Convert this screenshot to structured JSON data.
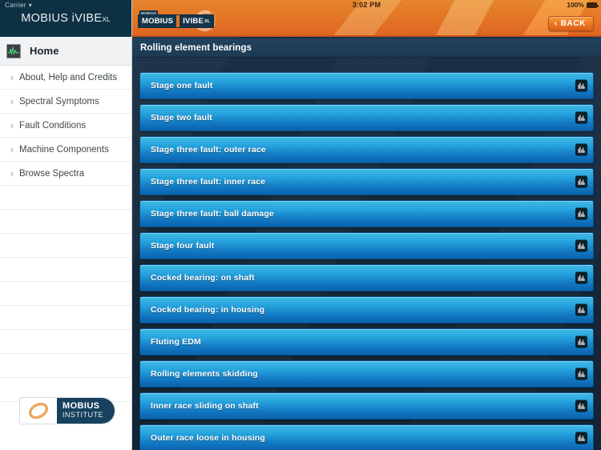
{
  "status_bar": {
    "carrier": "Carrier",
    "wifi_icon": "wifi-icon",
    "time": "3:02 PM",
    "battery_percent": "100%",
    "battery_icon": "battery-full-icon"
  },
  "sidebar": {
    "app_title": "MOBIUS iVIBE",
    "app_title_suffix": "XL",
    "home": {
      "label": "Home",
      "icon": "waveform-icon"
    },
    "items": [
      {
        "label": "About, Help and Credits",
        "icon": "chevron-right-icon"
      },
      {
        "label": "Spectral Symptoms",
        "icon": "chevron-right-icon"
      },
      {
        "label": "Fault Conditions",
        "icon": "chevron-right-icon"
      },
      {
        "label": "Machine Components",
        "icon": "chevron-right-icon"
      },
      {
        "label": "Browse Spectra",
        "icon": "chevron-right-icon"
      }
    ],
    "empty_row_count": 9,
    "footer_logo": {
      "mark_icon": "mobius-ellipse-icon",
      "line1": "MOBIUS",
      "line2": "INSTITUTE"
    }
  },
  "header": {
    "brand_badge": {
      "tag": "MOBIUS",
      "left": "MOBIUS",
      "right": "IVIBE",
      "right_suffix": "XL",
      "swoosh_icon": "mobius-swoosh-icon"
    },
    "back_button": {
      "label": "BACK",
      "chevron": "‹",
      "icon": "chevron-left-icon"
    }
  },
  "page": {
    "title": "Rolling element bearings"
  },
  "list": {
    "row_icon": "spectrum-chart-icon",
    "rows": [
      {
        "label": "Stage one fault"
      },
      {
        "label": "Stage two fault"
      },
      {
        "label": "Stage three fault: outer race"
      },
      {
        "label": "Stage three fault: inner race"
      },
      {
        "label": "Stage three fault: ball damage"
      },
      {
        "label": "Stage four fault"
      },
      {
        "label": "Cocked bearing: on shaft"
      },
      {
        "label": "Cocked bearing: in housing"
      },
      {
        "label": "Fluting EDM"
      },
      {
        "label": "Rolling elements skidding"
      },
      {
        "label": "Inner race sliding on shaft"
      },
      {
        "label": "Outer race loose in housing"
      }
    ]
  },
  "colors": {
    "navy_header": "#0d3042",
    "orange_accent": "#ef7c25",
    "row_blue_top": "#3fb9e4",
    "row_blue_bottom": "#0b63ad",
    "main_background": "#15293c",
    "title_bar": "#22435e"
  }
}
